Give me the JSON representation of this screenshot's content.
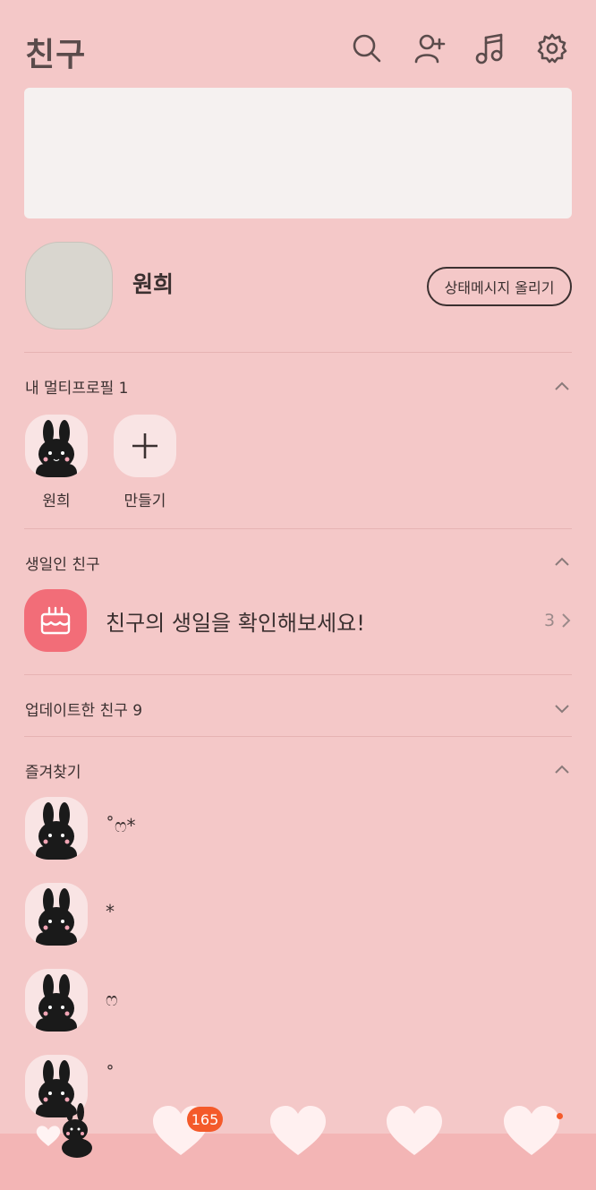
{
  "header": {
    "title": "친구",
    "icons": [
      "search-icon",
      "add-friend-icon",
      "music-icon",
      "settings-icon"
    ]
  },
  "profile": {
    "name": "원희",
    "status_button": "상태메시지 올리기"
  },
  "multi_profile": {
    "title": "내 멀티프로필 1",
    "items": [
      {
        "label": "원희"
      },
      {
        "label": "만들기"
      }
    ]
  },
  "birthday": {
    "title": "생일인 친구",
    "message": "친구의 생일을 확인해보세요!",
    "count": "3"
  },
  "updated": {
    "title": "업데이트한 친구 9"
  },
  "favorites": {
    "title": "즐겨찾기",
    "items": [
      {
        "name": "˚ෆ*"
      },
      {
        "name": "*"
      },
      {
        "name": "ෆ"
      },
      {
        "name": "˚"
      }
    ]
  },
  "tabbar": {
    "badge": "165"
  },
  "colors": {
    "background": "#f4c8c8",
    "accent": "#f45a2a",
    "birthday": "#f26d78"
  }
}
